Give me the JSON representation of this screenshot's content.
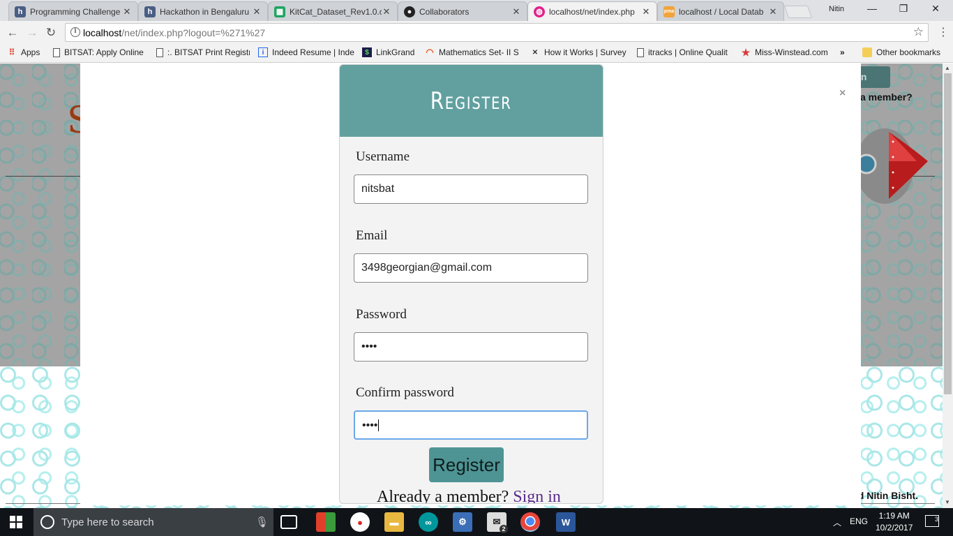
{
  "browser": {
    "tabs": [
      {
        "title": "Programming Challenge",
        "favicon": "hackerearth-icon"
      },
      {
        "title": "Hackathon in Bengaluru",
        "favicon": "hackerearth-icon"
      },
      {
        "title": "KitCat_Dataset_Rev1.0.c",
        "favicon": "sheets-icon"
      },
      {
        "title": "Collaborators",
        "favicon": "github-icon"
      },
      {
        "title": "localhost/net/index.php",
        "favicon": "localhost-icon",
        "active": true
      },
      {
        "title": "localhost / Local Datab",
        "favicon": "phpmyadmin-icon"
      }
    ],
    "profile_name": "Nitin",
    "url_host": "localhost",
    "url_path": "/net/index.php?logout=%271%27",
    "bookmarks": [
      {
        "label": "Apps",
        "icon": "apps-grid-icon"
      },
      {
        "label": "BITSAT: Apply Online",
        "icon": "page-icon"
      },
      {
        "label": ":. BITSAT Print Registr",
        "icon": "page-icon"
      },
      {
        "label": "Indeed Resume | Inde",
        "icon": "indeed-icon"
      },
      {
        "label": "LinkGrand",
        "icon": "linkgrand-icon"
      },
      {
        "label": "Mathematics Set- II S",
        "icon": "rainbow-icon"
      },
      {
        "label": "How it Works | Survey",
        "icon": "survey-icon"
      },
      {
        "label": "itracks | Online Qualit",
        "icon": "page-icon"
      },
      {
        "label": "Miss-Winstead.com",
        "icon": "star-icon"
      }
    ],
    "bookmarks_overflow": "»",
    "other_bookmarks": "Other bookmarks"
  },
  "background_page": {
    "logo_letter": "S",
    "signin_fragment": "in",
    "member_fragment": "a member?",
    "credits_fragment": "ad Nitin Bisht."
  },
  "modal": {
    "close_glyph": "×",
    "title": "Register",
    "fields": {
      "username": {
        "label": "Username",
        "value": "nitsbat"
      },
      "email": {
        "label": "Email",
        "value": "3498georgian@gmail.com"
      },
      "password": {
        "label": "Password",
        "value": "••••"
      },
      "confirm": {
        "label": "Confirm password",
        "value": "••••"
      }
    },
    "submit_label": "Register",
    "already_text": "Already a member?",
    "signin_link": "Sign in"
  },
  "taskbar": {
    "search_placeholder": "Type here to search",
    "language": "ENG",
    "time": "1:19 AM",
    "date": "10/2/2017",
    "notification_count": "3",
    "mail_badge": "2"
  },
  "colors": {
    "modal_header": "#62a0a0",
    "register_button": "#4f9495",
    "signin_link": "#5a2a8c"
  }
}
